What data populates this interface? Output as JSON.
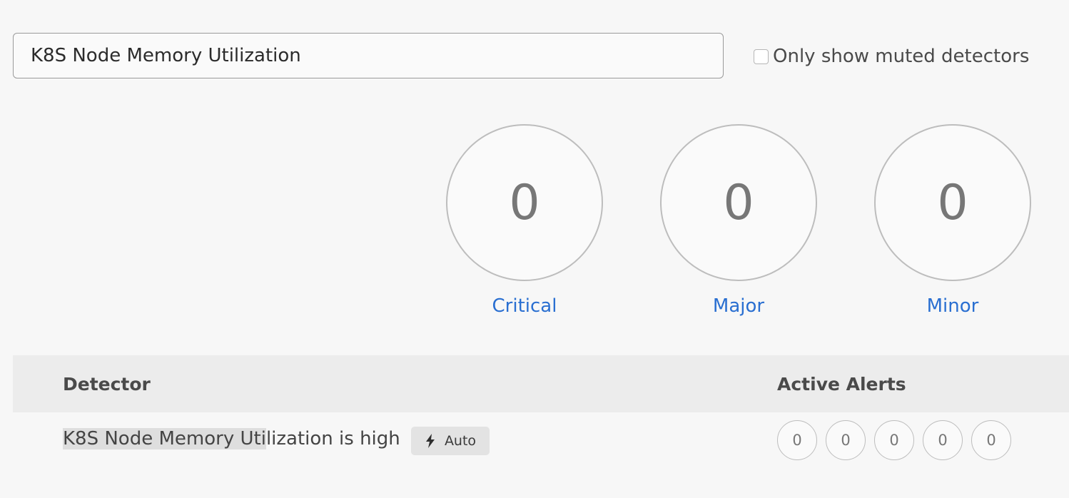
{
  "search": {
    "value": "K8S Node Memory Utilization"
  },
  "filter": {
    "muted_label": "Only show muted detectors",
    "muted_checked": false
  },
  "severity": {
    "critical": {
      "count": "0",
      "label": "Critical"
    },
    "major": {
      "count": "0",
      "label": "Major"
    },
    "minor": {
      "count": "0",
      "label": "Minor"
    }
  },
  "table": {
    "headers": {
      "detector": "Detector",
      "active_alerts": "Active Alerts"
    },
    "rows": [
      {
        "name_highlight": "K8S Node Memory Uti",
        "name_rest": "lization is high",
        "badge": "Auto",
        "badge_icon": "lightning-bolt-icon",
        "alerts": [
          "0",
          "0",
          "0",
          "0",
          "0"
        ]
      }
    ]
  },
  "colors": {
    "link": "#2a6fd1",
    "background": "#f7f7f7",
    "header_bg": "#ececec"
  }
}
